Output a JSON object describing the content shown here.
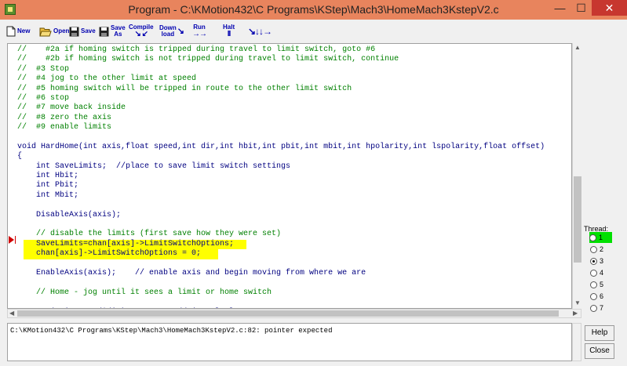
{
  "window": {
    "title": "Program - C:\\KMotion432\\C Programs\\KStep\\Mach3\\HomeMach3KstepV2.c",
    "min_glyph": "—",
    "max_glyph": "☐",
    "close_glyph": "✕"
  },
  "toolbar": {
    "new_label": "New",
    "open_label": "Open",
    "save_label": "Save",
    "saveas_line1": "Save",
    "saveas_line2": "As",
    "compile_label": "Compile",
    "compile_arrows": "↘ ↙",
    "download_line1": "Down",
    "download_line2": "load",
    "download_arrows": "↘",
    "run_label": "Run",
    "run_arrows": "→→",
    "halt_label": "Halt",
    "halt_glyph": "II",
    "step_arrows": "↘↓↓→"
  },
  "editor": {
    "lines": [
      "//    #2a if homing switch is tripped during travel to limit switch, goto #6",
      "//    #2b if homing switch is not tripped during travel to limit switch, continue",
      "//  #3 Stop",
      "//  #4 jog to the other limit at speed",
      "//  #5 homing switch will be tripped in route to the other limit switch",
      "//  #6 stop",
      "//  #7 move back inside",
      "//  #8 zero the axis",
      "//  #9 enable limits",
      "",
      "void HardHome(int axis,float speed,int dir,int hbit,int pbit,int mbit,int hpolarity,int lspolarity,float offset)",
      "{",
      "    int SaveLimits;  //place to save limit switch settings",
      "    int Hbit;",
      "    int Pbit;",
      "    int Mbit;",
      "",
      "    DisableAxis(axis);",
      "",
      "    // disable the limits (first save how they were set)",
      "    SaveLimits=chan[axis]->LimitSwitchOptions;",
      "    chan[axis]->LimitSwitchOptions = 0;",
      "",
      "    EnableAxis(axis);    // enable axis and begin moving from where we are",
      "",
      "    // Home - jog until it sees a limit or home switch",
      "",
      "    Jog(axis,speed*dir);          // jog slowly"
    ],
    "highlight_color": "#ffff00",
    "comment_color": "#008000",
    "keyword_color": "#000080"
  },
  "threads": {
    "label": "Thread:",
    "items": [
      "1",
      "2",
      "3",
      "4",
      "5",
      "6",
      "7"
    ],
    "selected": "3",
    "running": "1"
  },
  "output": {
    "message": "C:\\KMotion432\\C Programs\\KStep\\Mach3\\HomeMach3KstepV2.c:82: pointer expected"
  },
  "buttons": {
    "help": "Help",
    "close": "Close"
  }
}
